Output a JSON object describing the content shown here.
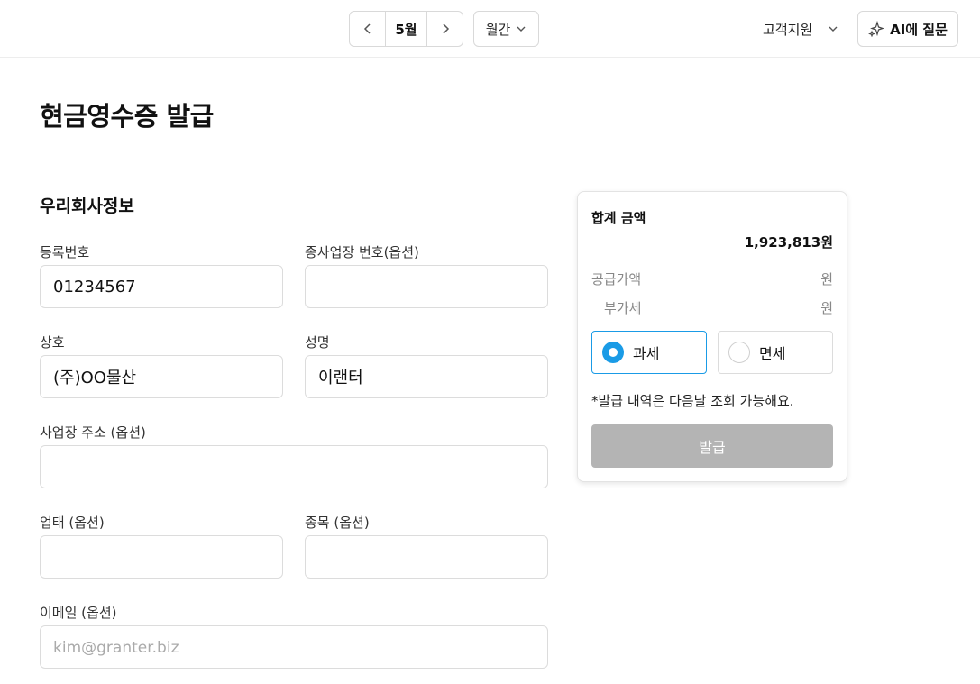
{
  "topbar": {
    "month": "5월",
    "period": "월간",
    "support": "고객지원",
    "ai_button": "AI에 질문"
  },
  "page": {
    "title": "현금영수증 발급",
    "section_title": "우리회사정보"
  },
  "form": {
    "reg_number": {
      "label": "등록번호",
      "value": "01234567"
    },
    "branch_number": {
      "label": "종사업장 번호(옵션)",
      "value": ""
    },
    "company": {
      "label": "상호",
      "value": "(주)OO물산"
    },
    "name": {
      "label": "성명",
      "value": "이랜터"
    },
    "address": {
      "label": "사업장 주소 (옵션)",
      "value": ""
    },
    "business_type": {
      "label": "업태 (옵션)",
      "value": ""
    },
    "item": {
      "label": "종목 (옵션)",
      "value": ""
    },
    "email": {
      "label": "이메일 (옵션)",
      "value": "",
      "placeholder": "kim@granter.biz"
    }
  },
  "summary": {
    "total_label": "합계 금액",
    "total_value": "1,923,813원",
    "supply_label": "공급가액",
    "supply_value": "원",
    "vat_label": "부가세",
    "vat_value": "원",
    "tax_options": [
      {
        "label": "과세",
        "selected": true
      },
      {
        "label": "면세",
        "selected": false
      }
    ],
    "notice": "*발급 내역은 다음날 조회 가능해요.",
    "issue_button": "발급"
  },
  "colors": {
    "accent": "#1a9be6",
    "disabled_button": "#b4b4b4"
  }
}
